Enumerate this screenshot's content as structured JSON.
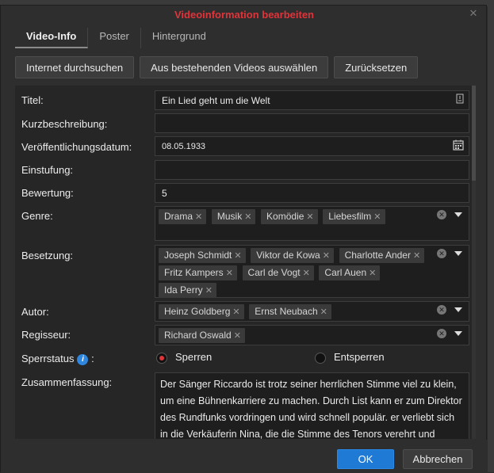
{
  "dialog": {
    "title": "Videoinformation bearbeiten"
  },
  "tabs": [
    {
      "label": "Video-Info"
    },
    {
      "label": "Poster"
    },
    {
      "label": "Hintergrund"
    }
  ],
  "toolbar": {
    "search_label": "Internet durchsuchen",
    "select_existing_label": "Aus bestehenden Videos auswählen",
    "reset_label": "Zurücksetzen"
  },
  "form": {
    "title": {
      "label": "Titel:",
      "value": "Ein Lied geht um die Welt"
    },
    "tagline": {
      "label": "Kurzbeschreibung:",
      "value": ""
    },
    "release_date": {
      "label": "Veröffentlichungsdatum:",
      "value": "08.05.1933"
    },
    "rating_class": {
      "label": "Einstufung:",
      "value": ""
    },
    "rating": {
      "label": "Bewertung:",
      "value": "5"
    },
    "genre": {
      "label": "Genre:",
      "tags": [
        "Drama",
        "Musik",
        "Komödie",
        "Liebesfilm"
      ]
    },
    "cast": {
      "label": "Besetzung:",
      "tags": [
        "Joseph Schmidt",
        "Viktor de Kowa",
        "Charlotte Ander",
        "Fritz Kampers",
        "Carl de Vogt",
        "Carl Auen",
        "Ida Perry"
      ]
    },
    "writer": {
      "label": "Autor:",
      "tags": [
        "Heinz Goldberg",
        "Ernst Neubach"
      ]
    },
    "director": {
      "label": "Regisseur:",
      "tags": [
        "Richard Oswald"
      ]
    },
    "lock_status": {
      "label": "Sperrstatus",
      "suffix": ":",
      "options": [
        "Sperren",
        "Entsperren"
      ],
      "selected": "Sperren"
    },
    "summary": {
      "label": "Zusammenfassung:",
      "value": "Der Sänger Riccardo ist trotz seiner herrlichen Stimme viel zu klein, um eine Bühnenkarriere zu machen. Durch List kann er zum Direktor des Rundfunks vordringen und wird schnell populär. er verliebt sich in die Verkäuferin Nina, die die Stimme des Tenors verehrt und"
    }
  },
  "footer": {
    "ok_label": "OK",
    "cancel_label": "Abbrechen"
  },
  "colors": {
    "title_red": "#e0343a",
    "primary_blue": "#1f7ad6",
    "background": "#2e2e2e"
  }
}
